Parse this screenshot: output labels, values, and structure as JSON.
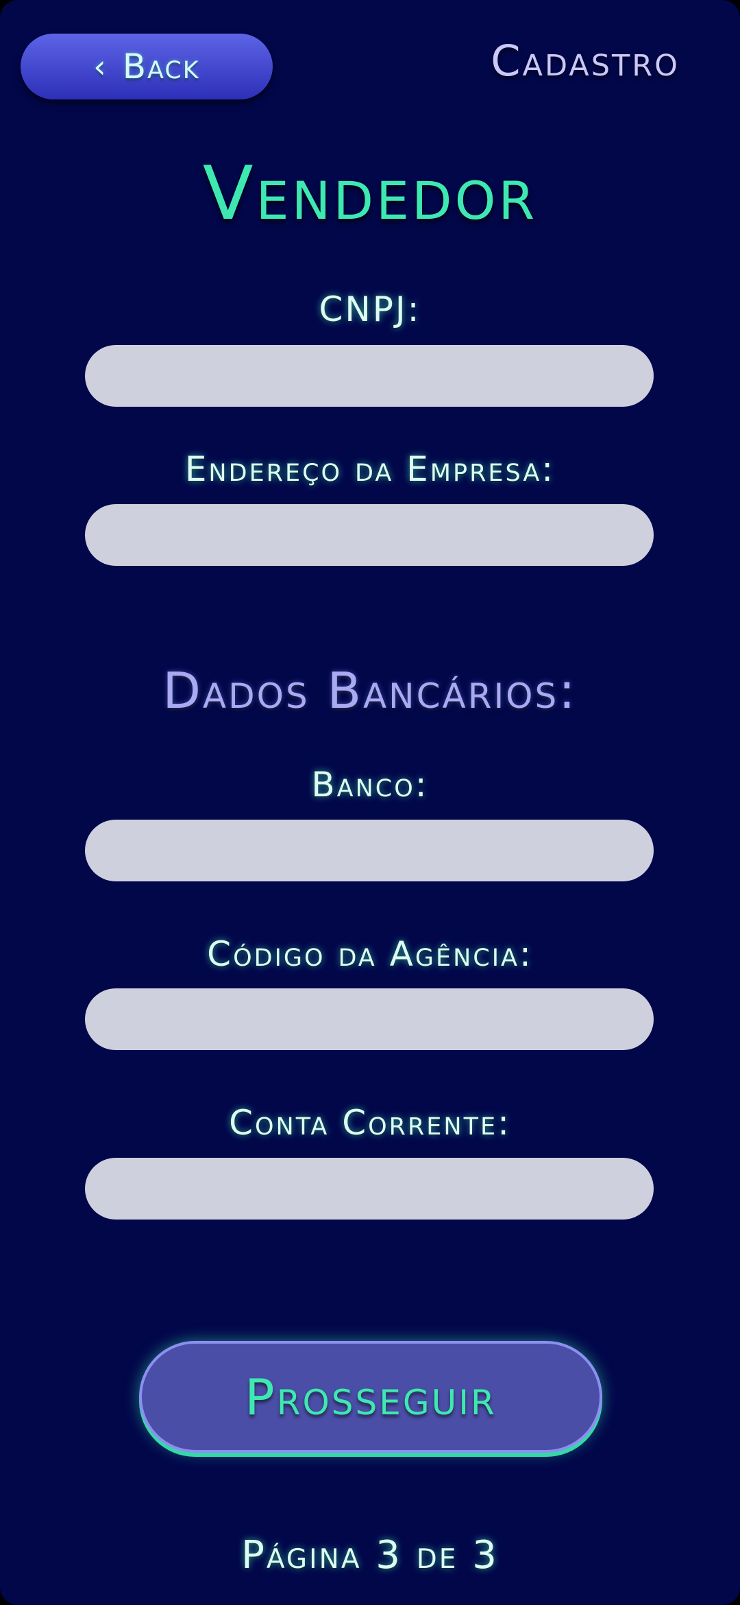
{
  "header": {
    "back_label": "Back",
    "title": "Cadastro"
  },
  "form": {
    "heading": "Vendedor",
    "cnpj_label": "CNPJ:",
    "cnpj_value": "",
    "address_label": "Endereço da Empresa:",
    "address_value": "",
    "bank_section_title": "Dados Bancários:",
    "bank_label": "Banco:",
    "bank_value": "",
    "agency_label": "Código da Agência:",
    "agency_value": "",
    "account_label": "Conta Corrente:",
    "account_value": ""
  },
  "actions": {
    "proceed_label": "Prosseguir"
  },
  "footer": {
    "page_indicator": "Página 3 de 3"
  },
  "icons": {
    "back": "chevron-left-icon"
  },
  "colors": {
    "background": "#02074a",
    "accent": "#3ee9b1",
    "button": "#4a4ea6",
    "field": "#cfd0de"
  }
}
